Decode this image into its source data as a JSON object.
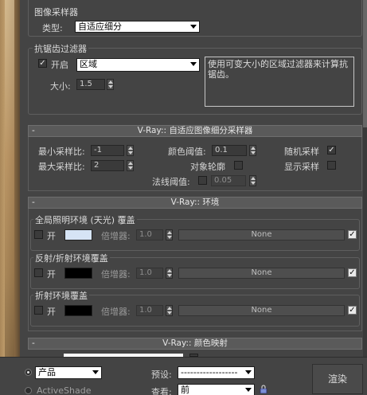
{
  "image_sampler": {
    "group_title": "图像采样器",
    "type_label": "类型:",
    "type_value": "自适应细分"
  },
  "aa_filter": {
    "group_title": "抗锯齿过滤器",
    "on_label": "开启",
    "on_checked": true,
    "filter_value": "区域",
    "description": "使用可变大小的区域过滤器来计算抗锯齿。",
    "size_label": "大小:",
    "size_value": "1.5"
  },
  "adaptive_rollout": {
    "header": "V-Ray:: 自适应图像细分采样器",
    "collapse": "-",
    "min_rate_label": "最小采样比:",
    "min_rate_value": "-1",
    "max_rate_label": "最大采样比:",
    "max_rate_value": "2",
    "clr_thresh_label": "颜色阈值:",
    "clr_thresh_value": "0.1",
    "object_outline_label": "对象轮廓",
    "object_outline_checked": false,
    "normal_thresh_label": "法线阈值:",
    "normal_thresh_value": "0.05",
    "normal_thresh_checked": false,
    "randomize_label": "随机采样",
    "randomize_checked": true,
    "show_samples_label": "显示采样",
    "show_samples_checked": false
  },
  "environment_rollout": {
    "header": "V-Ray:: 环境",
    "collapse": "-",
    "gi_group_title": "全局照明环境 (天光) 覆盖",
    "reflect_group_title": "反射/折射环境覆盖",
    "refract_group_title": "折射环境覆盖",
    "on_label": "开",
    "multiplier_label": "倍增器:",
    "multiplier_value": "1.0",
    "none_label": "None",
    "gi_color": "#d6e4f5",
    "reflect_color": "#000000",
    "refract_color": "#000000",
    "gi_on": false,
    "reflect_on": false,
    "refract_on": false,
    "map_checked": true
  },
  "color_mapping_rollout": {
    "header": "V-Ray:: 颜色映射",
    "collapse": "-"
  },
  "bottom_bar": {
    "product_value": "产品",
    "activeshade_label": "ActiveShade",
    "preset_label": "预设:",
    "preset_value": "------------------",
    "view_label": "查看:",
    "view_value": "前",
    "render_label": "渲染"
  }
}
